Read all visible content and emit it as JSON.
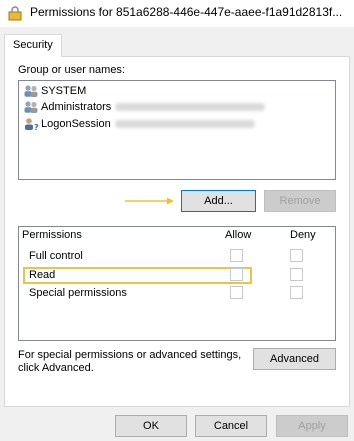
{
  "window": {
    "title": "Permissions for 851a6288-446e-447e-aaee-f1a91d2813f..."
  },
  "tabs": [
    {
      "label": "Security"
    }
  ],
  "security": {
    "group_label": "Group or user names:",
    "users": [
      {
        "name": "SYSTEM",
        "icon": "users-icon"
      },
      {
        "name": "Administrators",
        "icon": "users-icon"
      },
      {
        "name": "LogonSession",
        "icon": "user-icon"
      }
    ],
    "add_label": "Add...",
    "remove_label": "Remove",
    "permissions_header": "Permissions",
    "allow_header": "Allow",
    "deny_header": "Deny",
    "permissions": [
      {
        "name": "Full control",
        "allow": false,
        "deny": false
      },
      {
        "name": "Read",
        "allow": false,
        "deny": false
      },
      {
        "name": "Special permissions",
        "allow": false,
        "deny": false
      }
    ],
    "advanced_text": "For special permissions or advanced settings, click Advanced.",
    "advanced_label": "Advanced"
  },
  "footer": {
    "ok_label": "OK",
    "cancel_label": "Cancel",
    "apply_label": "Apply"
  },
  "colors": {
    "arrow": "#f0c22b",
    "highlight": "#e8c547",
    "focus_border": "#0078d7"
  }
}
